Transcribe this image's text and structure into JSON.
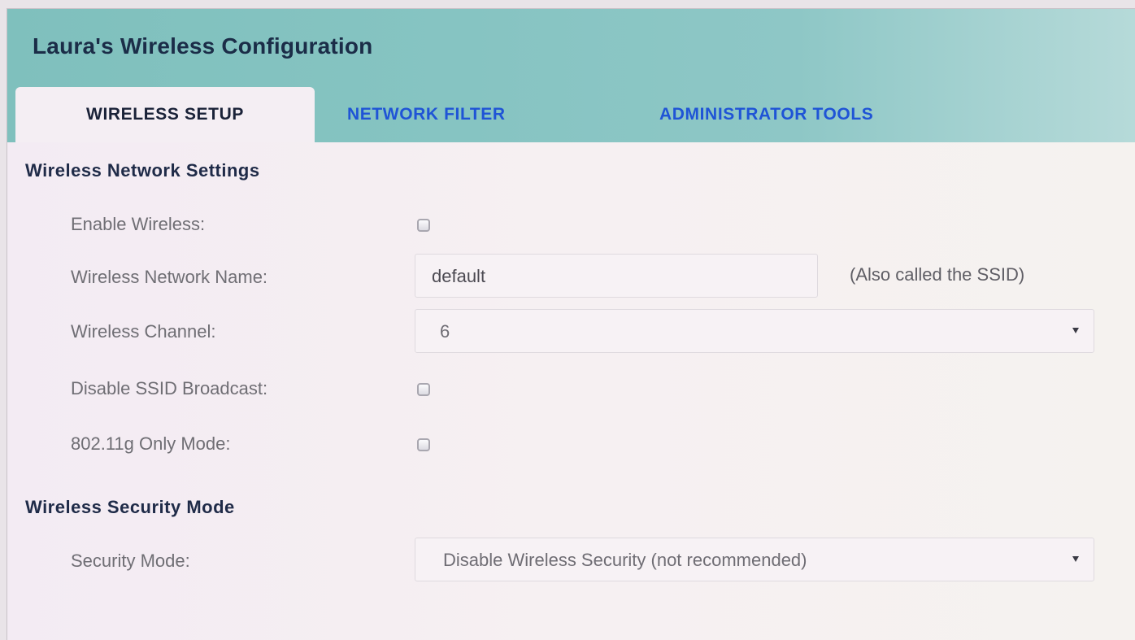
{
  "app": {
    "title": "Laura's Wireless Configuration"
  },
  "tabs": [
    {
      "label": "WIRELESS SETUP",
      "active": true
    },
    {
      "label": "NETWORK FILTER",
      "active": false
    },
    {
      "label": "ADMINISTRATOR TOOLS",
      "active": false
    }
  ],
  "wireless_network_settings": {
    "heading": "Wireless Network Settings",
    "enable_wireless": {
      "label": "Enable Wireless:",
      "checked": false
    },
    "network_name": {
      "label": "Wireless Network Name:",
      "value": "default",
      "hint": "(Also called the SSID)"
    },
    "channel": {
      "label": "Wireless Channel:",
      "value": "6"
    },
    "disable_ssid_broadcast": {
      "label": "Disable SSID Broadcast:",
      "checked": false
    },
    "g_only_mode": {
      "label": "802.11g Only Mode:",
      "checked": false
    }
  },
  "wireless_security_mode": {
    "heading": "Wireless Security Mode",
    "security_mode": {
      "label": "Security Mode:",
      "value": "Disable Wireless Security (not recommended)"
    }
  },
  "colors": {
    "header": "#86c4c2",
    "tab_link": "#1f54d6",
    "heading_text": "#1f2b48"
  }
}
